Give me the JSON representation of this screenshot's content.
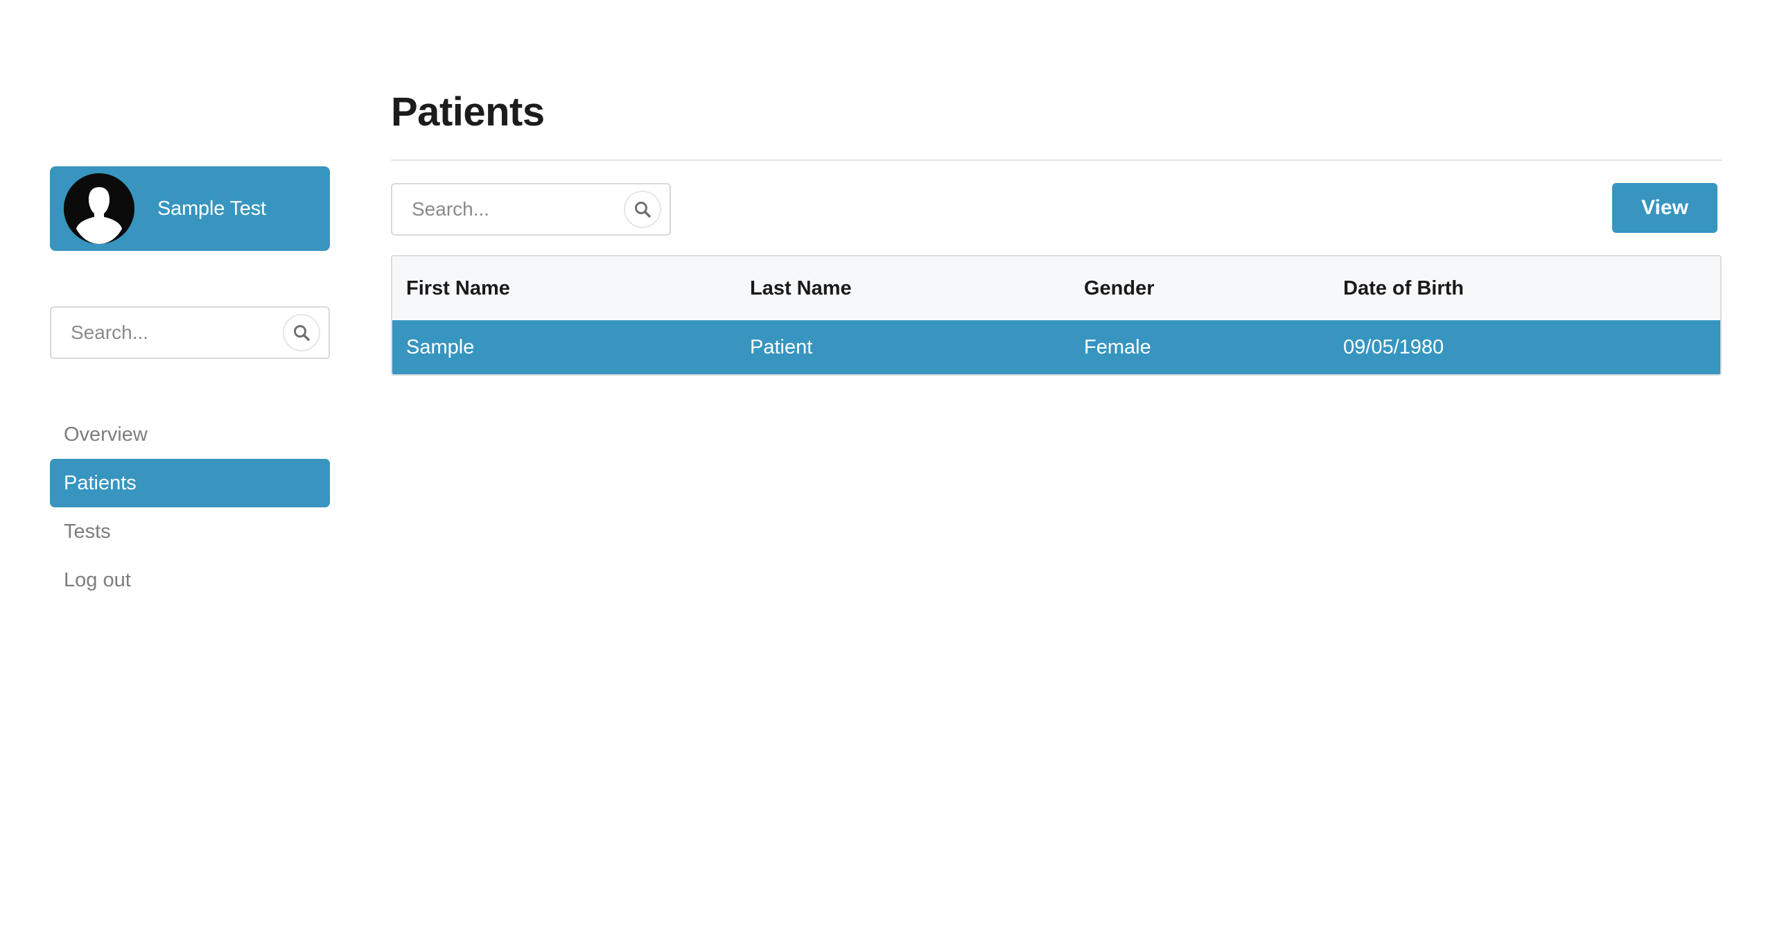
{
  "colors": {
    "accent": "#3795c0",
    "text_muted": "#7d7d7d"
  },
  "user": {
    "name": "Sample Test",
    "avatar_icon": "user-silhouette-icon"
  },
  "sidebar": {
    "search": {
      "placeholder": "Search...",
      "icon": "search-icon"
    },
    "items": [
      {
        "label": "Overview",
        "active": false
      },
      {
        "label": "Patients",
        "active": true
      },
      {
        "label": "Tests",
        "active": false
      },
      {
        "label": "Log out",
        "active": false
      }
    ]
  },
  "main": {
    "title": "Patients",
    "search": {
      "placeholder": "Search...",
      "icon": "search-icon"
    },
    "view_label": "View",
    "table": {
      "headers": [
        "First Name",
        "Last Name",
        "Gender",
        "Date of Birth"
      ],
      "rows": [
        [
          "Sample",
          "Patient",
          "Female",
          "09/05/1980"
        ]
      ],
      "selected_row": 0
    }
  }
}
